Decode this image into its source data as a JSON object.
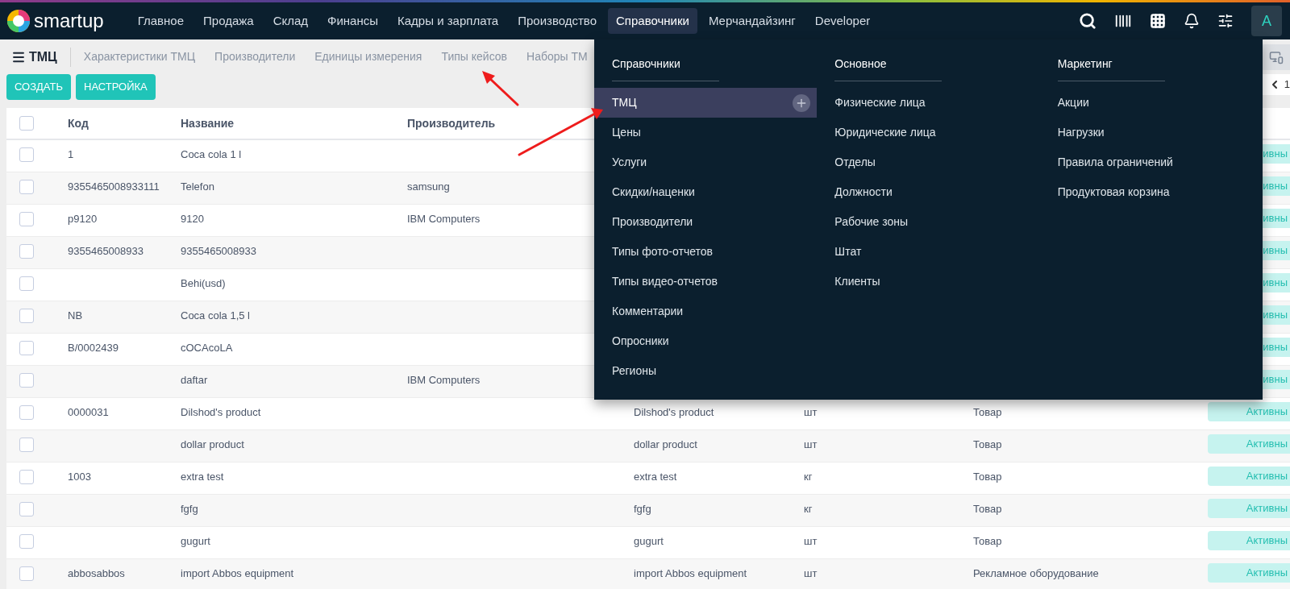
{
  "topbar": {
    "logo": "smartup",
    "nav": [
      {
        "label": "Главное",
        "selected": false
      },
      {
        "label": "Продажа",
        "selected": false
      },
      {
        "label": "Склад",
        "selected": false
      },
      {
        "label": "Финансы",
        "selected": false
      },
      {
        "label": "Кадры и зарплата",
        "selected": false
      },
      {
        "label": "Производство",
        "selected": false
      },
      {
        "label": "Справочники",
        "selected": true
      },
      {
        "label": "Мерчандайзинг",
        "selected": false
      },
      {
        "label": "Developer",
        "selected": false
      }
    ],
    "avatar": "A"
  },
  "subnav": {
    "title": "ТМЦ",
    "links": [
      "Характеристики ТМЦ",
      "Производители",
      "Единицы измерения",
      "Типы кейсов",
      "Наборы ТМ"
    ],
    "pager": "1"
  },
  "buttons": [
    "СОЗДАТЬ",
    "НАСТРОЙКА"
  ],
  "table": {
    "select_all": {
      "checked": false
    },
    "columns": [
      "Код",
      "Название",
      "Производитель"
    ],
    "rows": [
      {
        "checked": false,
        "code": "1",
        "name": "Coca cola 1 l",
        "status": "ивны"
      },
      {
        "checked": false,
        "code": "9355465008933111",
        "name": "Telefon",
        "producer": "samsung",
        "status": "ивны"
      },
      {
        "checked": false,
        "code": "p9120",
        "name": "9120",
        "producer": "IBM Computers",
        "status": "ивны"
      },
      {
        "checked": false,
        "code": "9355465008933",
        "name": "9355465008933",
        "status": "ивны"
      },
      {
        "checked": false,
        "name": "Behi(usd)",
        "status": "ивны"
      },
      {
        "checked": false,
        "code": "NB",
        "name": "Coca cola 1,5 l",
        "status": "ивны"
      },
      {
        "checked": false,
        "code": "B/0002439",
        "name": "cOCAcoLA",
        "status": "ивны"
      },
      {
        "checked": false,
        "name": "daftar",
        "producer": "IBM Computers",
        "status": "ивны"
      },
      {
        "checked": false,
        "code": "0000031",
        "name": "Dilshod's product",
        "short_name": "Dilshod's product",
        "unit": "шт",
        "type": "Товар",
        "status": "Активны"
      },
      {
        "checked": false,
        "name": "dollar product",
        "short_name": "dollar product",
        "unit": "шт",
        "type": "Товар",
        "status": "Активны"
      },
      {
        "checked": false,
        "code": "1003",
        "name": "extra test",
        "short_name": "extra test",
        "unit": "кг",
        "type": "Товар",
        "status": "Активны"
      },
      {
        "checked": false,
        "name": "fgfg",
        "short_name": "fgfg",
        "unit": "кг",
        "type": "Товар",
        "status": "Активны"
      },
      {
        "checked": false,
        "name": "gugurt",
        "short_name": "gugurt",
        "unit": "шт",
        "type": "Товар",
        "status": "Активны"
      },
      {
        "checked": false,
        "code": "abbosabbos",
        "name": "import Abbos equipment",
        "short_name": "import Abbos equipment",
        "unit": "шт",
        "type": "Рекламное оборудование",
        "status": "Активны"
      }
    ]
  },
  "dropdown": {
    "columns": [
      {
        "heading": "Справочники",
        "items": [
          {
            "label": "ТМЦ",
            "selected": true
          },
          {
            "label": "Цены",
            "selected": false
          },
          {
            "label": "Услуги",
            "selected": false
          },
          {
            "label": "Скидки/наценки",
            "selected": false
          },
          {
            "label": "Производители",
            "selected": false
          },
          {
            "label": "Типы фото-отчетов",
            "selected": false
          },
          {
            "label": "Типы видео-отчетов",
            "selected": false
          },
          {
            "label": "Комментарии",
            "selected": false
          },
          {
            "label": "Опросники",
            "selected": false
          },
          {
            "label": "Регионы",
            "selected": false
          }
        ]
      },
      {
        "heading": "Основное",
        "items": [
          {
            "label": "Физические лица",
            "selected": false
          },
          {
            "label": "Юридические лица",
            "selected": false
          },
          {
            "label": "Отделы",
            "selected": false
          },
          {
            "label": "Должности",
            "selected": false
          },
          {
            "label": "Рабочие зоны",
            "selected": false
          },
          {
            "label": "Штат",
            "selected": false
          },
          {
            "label": "Клиенты",
            "selected": false
          }
        ]
      },
      {
        "heading": "Маркетинг",
        "items": [
          {
            "label": "Акции",
            "selected": false
          },
          {
            "label": "Нагрузки",
            "selected": false
          },
          {
            "label": "Правила ограничений",
            "selected": false
          },
          {
            "label": "Продуктовая корзина",
            "selected": false
          }
        ]
      }
    ]
  }
}
